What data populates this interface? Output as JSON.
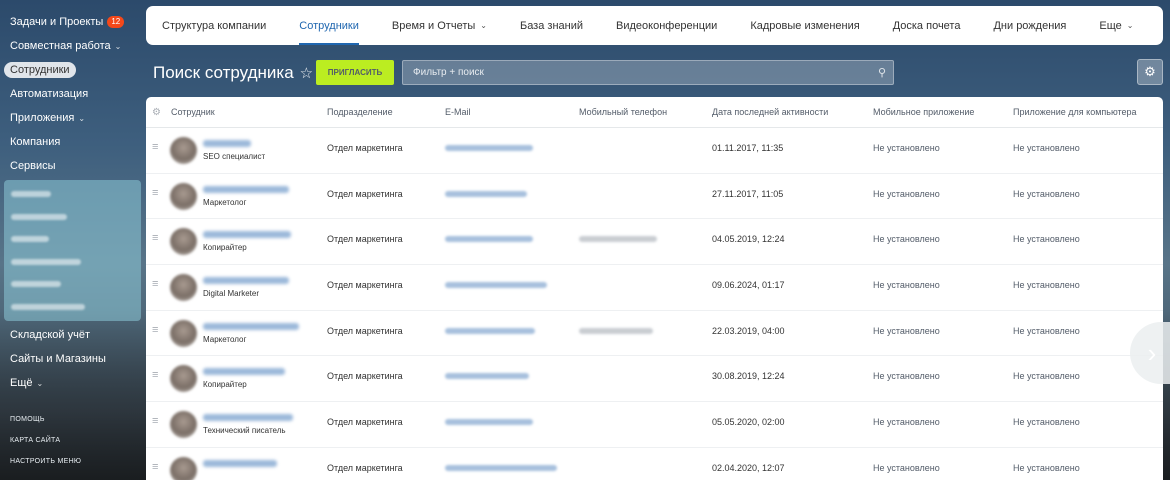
{
  "sidebar": {
    "items": [
      {
        "label": "Задачи и Проекты",
        "badge": "12"
      },
      {
        "label": "Совместная работа",
        "chev": "⌄"
      },
      {
        "label": "Сотрудники"
      },
      {
        "label": "Автоматизация"
      },
      {
        "label": "Приложения",
        "chev": "⌄"
      },
      {
        "label": "Компания"
      },
      {
        "label": "Сервисы"
      }
    ],
    "items_after": [
      {
        "label": "Складской учёт"
      },
      {
        "label": "Сайты и Магазины"
      },
      {
        "label": "Ещё",
        "chev": "⌄"
      }
    ],
    "links": [
      "ПОМОЩЬ",
      "КАРТА САЙТА",
      "НАСТРОИТЬ МЕНЮ"
    ]
  },
  "topnav": {
    "items": [
      {
        "label": "Структура компании"
      },
      {
        "label": "Сотрудники"
      },
      {
        "label": "Время и Отчеты",
        "chev": "⌄"
      },
      {
        "label": "База знаний"
      },
      {
        "label": "Видеоконференции"
      },
      {
        "label": "Кадровые изменения"
      },
      {
        "label": "Доска почета"
      },
      {
        "label": "Дни рождения"
      },
      {
        "label": "Еще",
        "chev": "⌄"
      }
    ]
  },
  "page": {
    "title": "Поиск сотрудника",
    "star": "☆",
    "invite_label": "ПРИГЛАСИТЬ",
    "search_placeholder": "Фильтр + поиск",
    "search_icon": "⚲",
    "settings_icon": "⚙"
  },
  "table": {
    "gear_icon": "⚙",
    "drag_icon": "≡",
    "columns": [
      "Сотрудник",
      "Подразделение",
      "E-Mail",
      "Мобильный телефон",
      "Дата последней активности",
      "Мобильное приложение",
      "Приложение для компьютера"
    ],
    "rows": [
      {
        "position": "SEO специалист",
        "department": "Отдел маркетинга",
        "date": "01.11.2017, 11:35",
        "mobile_app": "Не установлено",
        "desktop_app": "Не установлено"
      },
      {
        "position": "Маркетолог",
        "department": "Отдел маркетинга",
        "date": "27.11.2017, 11:05",
        "mobile_app": "Не установлено",
        "desktop_app": "Не установлено"
      },
      {
        "position": "Копирайтер",
        "department": "Отдел маркетинга",
        "date": "04.05.2019, 12:24",
        "mobile_app": "Не установлено",
        "desktop_app": "Не установлено"
      },
      {
        "position": "Digital Marketer",
        "department": "Отдел маркетинга",
        "date": "09.06.2024, 01:17",
        "mobile_app": "Не установлено",
        "desktop_app": "Не установлено"
      },
      {
        "position": "Маркетолог",
        "department": "Отдел маркетинга",
        "date": "22.03.2019, 04:00",
        "mobile_app": "Не установлено",
        "desktop_app": "Не установлено"
      },
      {
        "position": "Копирайтер",
        "department": "Отдел маркетинга",
        "date": "30.08.2019, 12:24",
        "mobile_app": "Не установлено",
        "desktop_app": "Не установлено"
      },
      {
        "position": "Технический писатель",
        "department": "Отдел маркетинга",
        "date": "05.05.2020, 02:00",
        "mobile_app": "Не установлено",
        "desktop_app": "Не установлено"
      },
      {
        "position": "",
        "department": "Отдел маркетинга",
        "date": "02.04.2020, 12:07",
        "mobile_app": "Не установлено",
        "desktop_app": "Не установлено"
      }
    ]
  },
  "pager": {
    "next_icon": "›"
  }
}
